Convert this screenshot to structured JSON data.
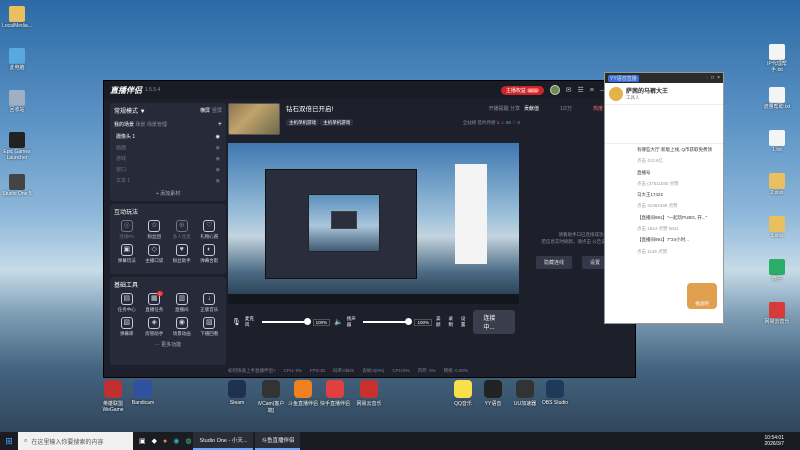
{
  "desktop_left": [
    {
      "label": "LocalMedia...",
      "color": "#e8c060"
    },
    {
      "label": "此电脑",
      "color": "#5aa8e0"
    },
    {
      "label": "回收站",
      "color": "#9fb0c4"
    },
    {
      "label": "Epic Games Launcher",
      "color": "#222222"
    },
    {
      "label": "Studio One 5",
      "color": "#444444"
    }
  ],
  "desktop_right": [
    {
      "label": "IP代理帮手.txt",
      "color": "#f4f4f4"
    },
    {
      "label": "流量帮助.txt",
      "color": "#f4f4f4"
    },
    {
      "label": "1.txt",
      "color": "#f4f4f4"
    },
    {
      "label": "2.xlsx",
      "color": "#e8c060"
    },
    {
      "label": "3.xlsx",
      "color": "#e8c060"
    },
    {
      "label": "微信",
      "color": "#2aae67"
    },
    {
      "label": "网易云音乐",
      "color": "#d83a3a"
    }
  ],
  "main": {
    "logo": "直播伴侣",
    "version": "1.5.5.4",
    "titlebar_btn": "主播权益",
    "titlebar_badge": "NEW",
    "stream_title": "钻石双倍已开启!",
    "tags": [
      "主机单机游戏",
      "主机单机游戏"
    ],
    "mode_label": "常规模式 ▼",
    "mode_right": [
      "横屏",
      "竖屏"
    ],
    "scene_tabs": [
      "我的场景",
      "场景",
      "场景管理"
    ],
    "source_add": "+",
    "sources": [
      {
        "name": "摄像头 1",
        "active": true
      },
      {
        "name": "画面",
        "active": false
      },
      {
        "name": "游戏",
        "active": false
      },
      {
        "name": "窗口",
        "active": false
      },
      {
        "name": "文本 1",
        "active": false
      }
    ],
    "add_material": "+ 添加素材",
    "interact_title": "互动玩法",
    "interact_tools": [
      {
        "label": "连线PK",
        "dim": true,
        "icon": "◎"
      },
      {
        "label": "粉丝团",
        "dim": false,
        "icon": "☆"
      },
      {
        "label": "多人连麦",
        "dim": true,
        "icon": "⊕"
      },
      {
        "label": "礼物心愿",
        "dim": false,
        "icon": "♡"
      },
      {
        "label": "弹幕玩法",
        "dim": false,
        "icon": "▣"
      },
      {
        "label": "主播口袋",
        "dim": false,
        "icon": "◇"
      },
      {
        "label": "粉丝助手",
        "dim": false,
        "icon": "♥"
      },
      {
        "label": "弹幕合影",
        "dim": false,
        "icon": "◐"
      }
    ],
    "base_title": "基础工具",
    "base_tools": [
      {
        "label": "任务中心",
        "icon": "▤",
        "badge": ""
      },
      {
        "label": "直播任务",
        "icon": "▦",
        "badge": "1"
      },
      {
        "label": "直播间",
        "icon": "▥",
        "badge": ""
      },
      {
        "label": "正版音乐",
        "icon": "↓",
        "badge": ""
      },
      {
        "label": "弹幕库",
        "icon": "▧",
        "badge": ""
      },
      {
        "label": "房管助手",
        "icon": "◈",
        "badge": ""
      },
      {
        "label": "场景动画",
        "icon": "◉",
        "badge": ""
      },
      {
        "label": "下播回看",
        "icon": "▨",
        "badge": ""
      }
    ],
    "more": "··· 更多功能",
    "header_actions": [
      "开播提醒",
      "分享"
    ],
    "header_chips": [
      {
        "label": "全站榜",
        "value": ""
      },
      {
        "label": "签约月榜",
        "value": "1"
      },
      {
        "label": "",
        "value": "58"
      },
      {
        "label": "",
        "value": "0"
      }
    ],
    "mic_label": "麦克风",
    "mic_pct": "100%",
    "mic_level": 1.0,
    "speaker_label": "扬声器",
    "speaker_pct": "100%",
    "speaker_level": 1.0,
    "ctrl_icons": [
      "美颜",
      "录制",
      "设置"
    ],
    "live_btn": "连接中...",
    "status_text": [
      "如何快速上手直播伴侣?",
      "CPU: 9%",
      "FPS:30",
      "码率:0kb/s",
      "丢帧:0(0%)",
      "CPU:9%",
      "内存: 2%",
      "网络: 0.00%"
    ],
    "right_tabs": [
      "贡献值",
      "1/2万",
      "热度",
      "详情"
    ],
    "right_hint": "请看助手口已连接成功\n若信息实时刷新，请点击 公告说明 查看",
    "right_btns": [
      "隐藏连线",
      "设置"
    ]
  },
  "chat": {
    "topbar": [
      "YY语音直播",
      "·",
      "□",
      "×"
    ],
    "name": "萨茜的马裤大王",
    "sub": "工具人",
    "items": [
      "有哪些大厅·新版上线, Q币获取免费领",
      "点击 413.6亿",
      "直播号",
      "点击 (37511040 点赞",
      "马大王17422",
      "点击 31382438 点赞",
      "【直播间991】\"一起玩PUBG, 开...\"",
      "点击 1614 点赞 5841",
      "【直播间991】7\"24小时...",
      "点击 1136 点赞"
    ],
    "sticker": "挑战吧"
  },
  "dock": [
    {
      "label": "英雄联盟WeGame",
      "color": "#c03030"
    },
    {
      "label": "Bandicam",
      "color": "#3050a0"
    },
    {
      "label": "Steam",
      "color": "#203050"
    },
    {
      "label": "iVCam(客户端)",
      "color": "#333"
    },
    {
      "label": "斗鱼直播伴侣",
      "color": "#f08020"
    },
    {
      "label": "快手直播伴侣",
      "color": "#e04040"
    },
    {
      "label": "网易云音乐",
      "color": "#c83030"
    },
    {
      "label": "QQ音乐",
      "color": "#f7e04a"
    },
    {
      "label": "YY语音",
      "color": "#222"
    },
    {
      "label": "UU加速器",
      "color": "#333"
    },
    {
      "label": "OBS Studio",
      "color": "#1e3a5a"
    },
    {
      "label": "Steam",
      "color": "#0b2a45"
    }
  ],
  "taskbar": {
    "search_placeholder": "在这里输入你要搜索的内容",
    "apps": [
      "Studio One - 小天...",
      "斗鱼直播伴侣"
    ],
    "time": "10:54:01",
    "date": "2026/3/7"
  }
}
